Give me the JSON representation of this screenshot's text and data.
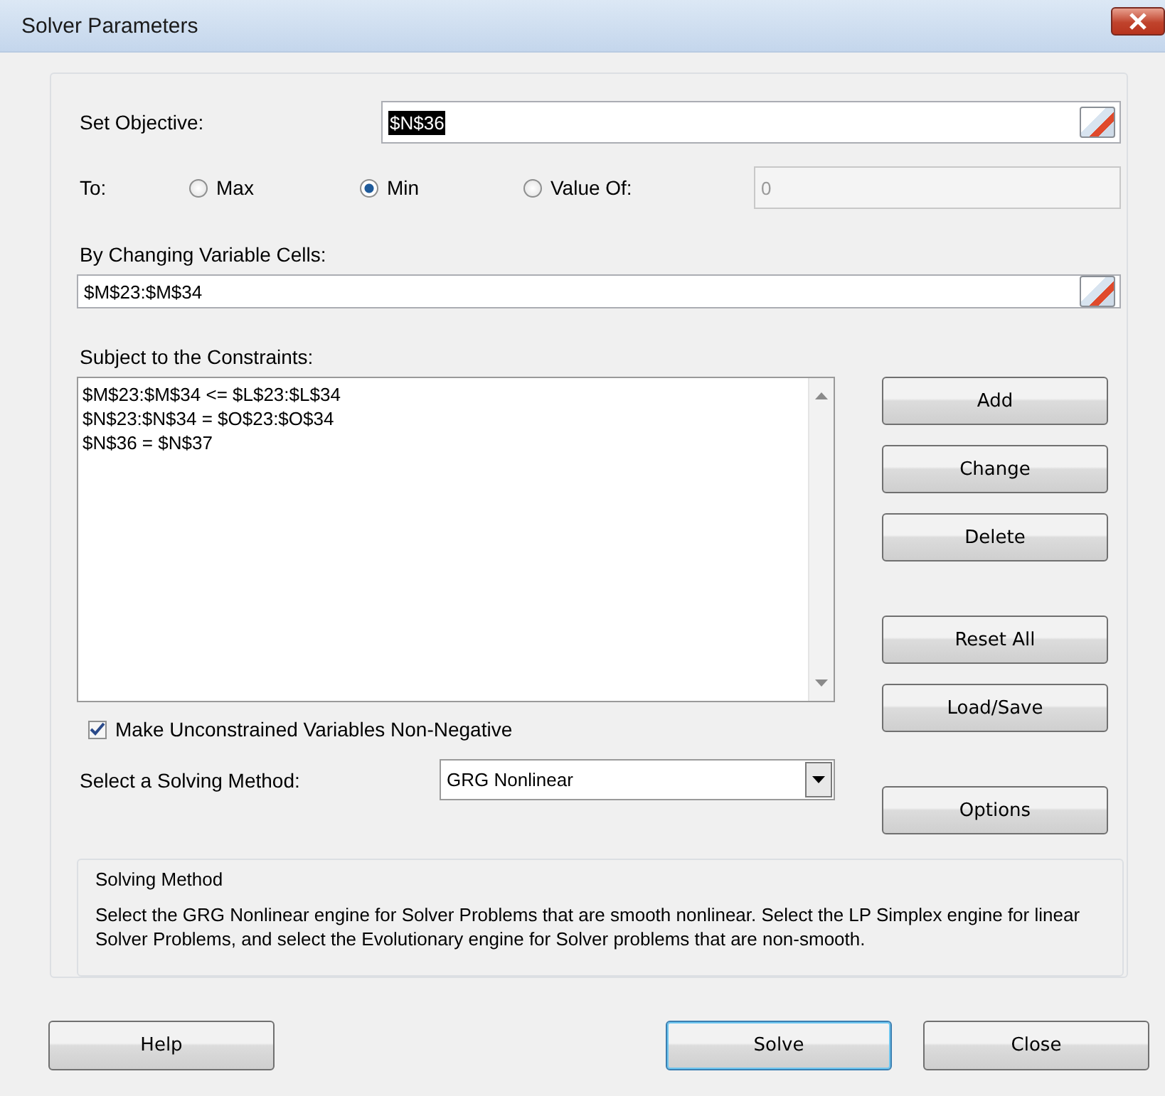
{
  "window": {
    "title": "Solver Parameters"
  },
  "objective": {
    "label": "Set Objective:",
    "value": "$N$36",
    "highlighted": true
  },
  "to": {
    "label": "To:",
    "options": [
      {
        "label": "Max",
        "selected": false
      },
      {
        "label": "Min",
        "selected": true
      },
      {
        "label": "Value Of:",
        "selected": false
      }
    ],
    "value_field": {
      "value": "0",
      "disabled": true
    }
  },
  "changing_cells": {
    "label": "By Changing Variable Cells:",
    "value": "$M$23:$M$34"
  },
  "constraints": {
    "label": "Subject to the Constraints:",
    "items": [
      "$M$23:$M$34 <= $L$23:$L$34",
      "$N$23:$N$34 = $O$23:$O$34",
      "$N$36 = $N$37"
    ]
  },
  "constraint_buttons": [
    "Add",
    "Change",
    "Delete",
    "Reset All",
    "Load/Save"
  ],
  "nonnegative": {
    "label": "Make Unconstrained Variables Non-Negative",
    "checked": true
  },
  "method": {
    "label": "Select a Solving Method:",
    "value": "GRG Nonlinear"
  },
  "options_button": "Options",
  "method_info": {
    "title": "Solving Method",
    "text": "Select the GRG Nonlinear engine for Solver Problems that are smooth nonlinear. Select the LP Simplex engine for linear Solver Problems, and select the Evolutionary engine for Solver problems that are non-smooth."
  },
  "footer_buttons": [
    {
      "label": "Help",
      "default": false
    },
    {
      "label": "Solve",
      "default": true
    },
    {
      "label": "Close",
      "default": false
    }
  ]
}
